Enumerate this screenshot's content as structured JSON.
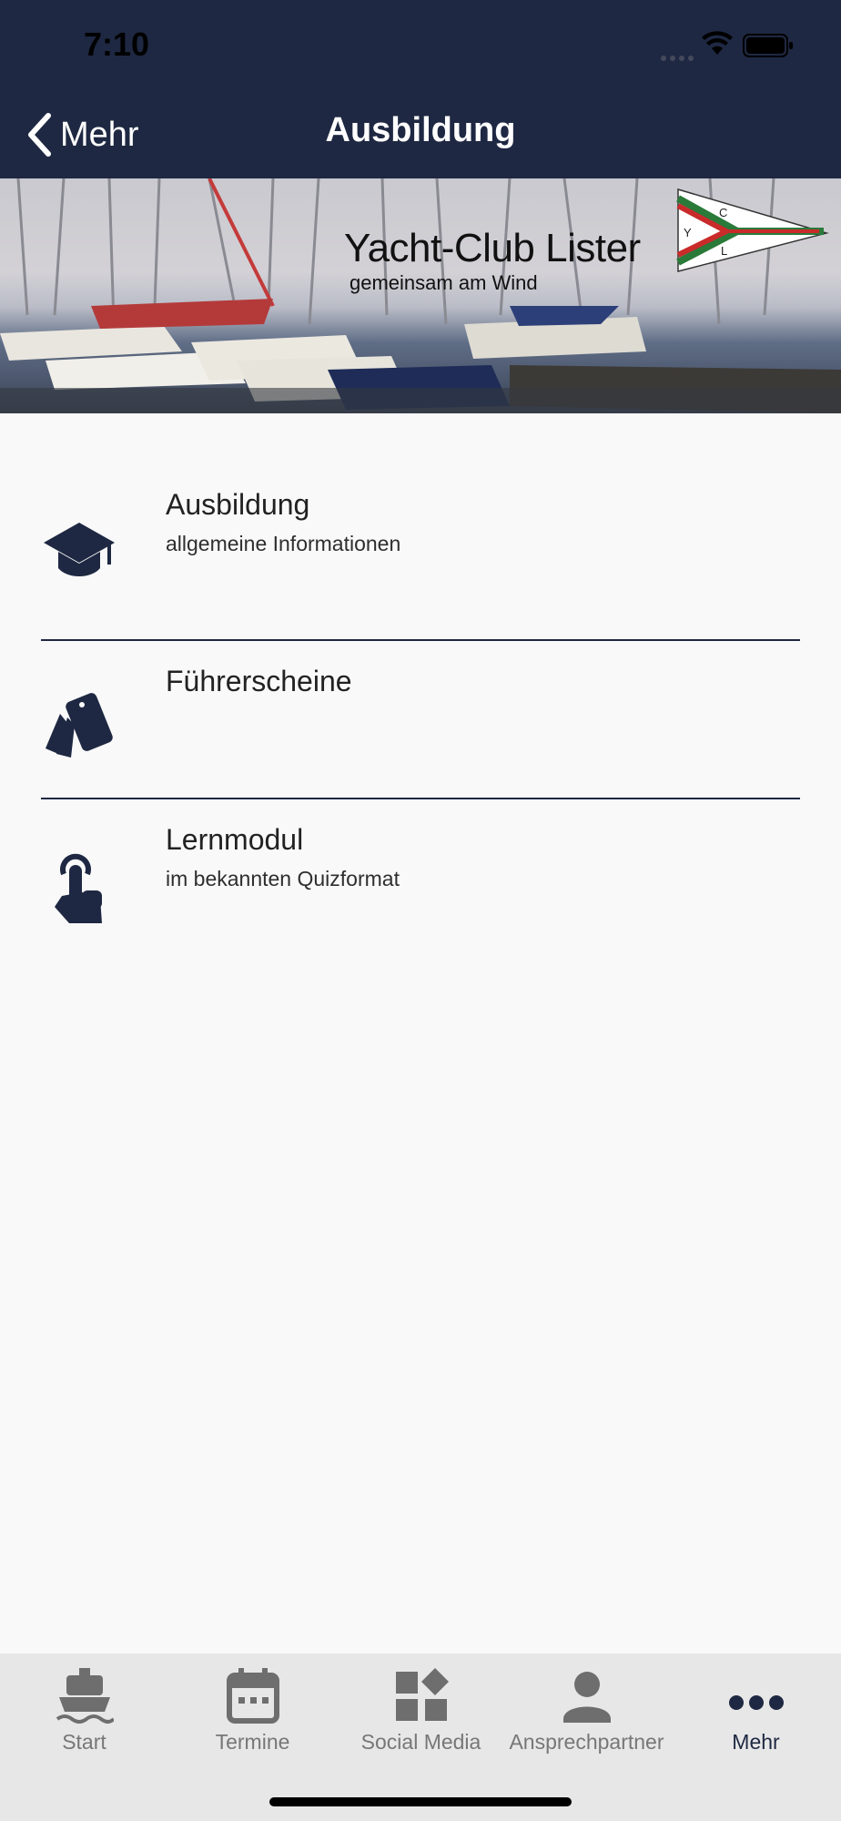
{
  "status_bar": {
    "time": "7:10"
  },
  "nav": {
    "back_label": "Mehr",
    "title": "Ausbildung"
  },
  "banner": {
    "club_name": "Yacht-Club Lister",
    "slogan": "gemeinsam am Wind",
    "pennant_letters": [
      "C",
      "Y",
      "L"
    ]
  },
  "list": [
    {
      "icon": "graduation-cap-icon",
      "title": "Ausbildung",
      "subtitle": "allgemeine Informationen"
    },
    {
      "icon": "license-cards-icon",
      "title": "Führerscheine",
      "subtitle": ""
    },
    {
      "icon": "pointer-hand-icon",
      "title": "Lernmodul",
      "subtitle": "im bekannten Quizformat"
    }
  ],
  "tabbar": {
    "tabs": [
      {
        "label": "Start",
        "icon": "ship-icon",
        "active": false
      },
      {
        "label": "Termine",
        "icon": "calendar-icon",
        "active": false
      },
      {
        "label": "Social Media",
        "icon": "widgets-icon",
        "active": false
      },
      {
        "label": "Ansprechpartner",
        "icon": "person-icon",
        "active": false
      },
      {
        "label": "Mehr",
        "icon": "more-dots-icon",
        "active": true
      }
    ]
  },
  "colors": {
    "header_bg": "#1e2842",
    "accent": "#1e2842",
    "inactive_tab": "#777777",
    "tabbar_bg": "#e7e7e7"
  }
}
